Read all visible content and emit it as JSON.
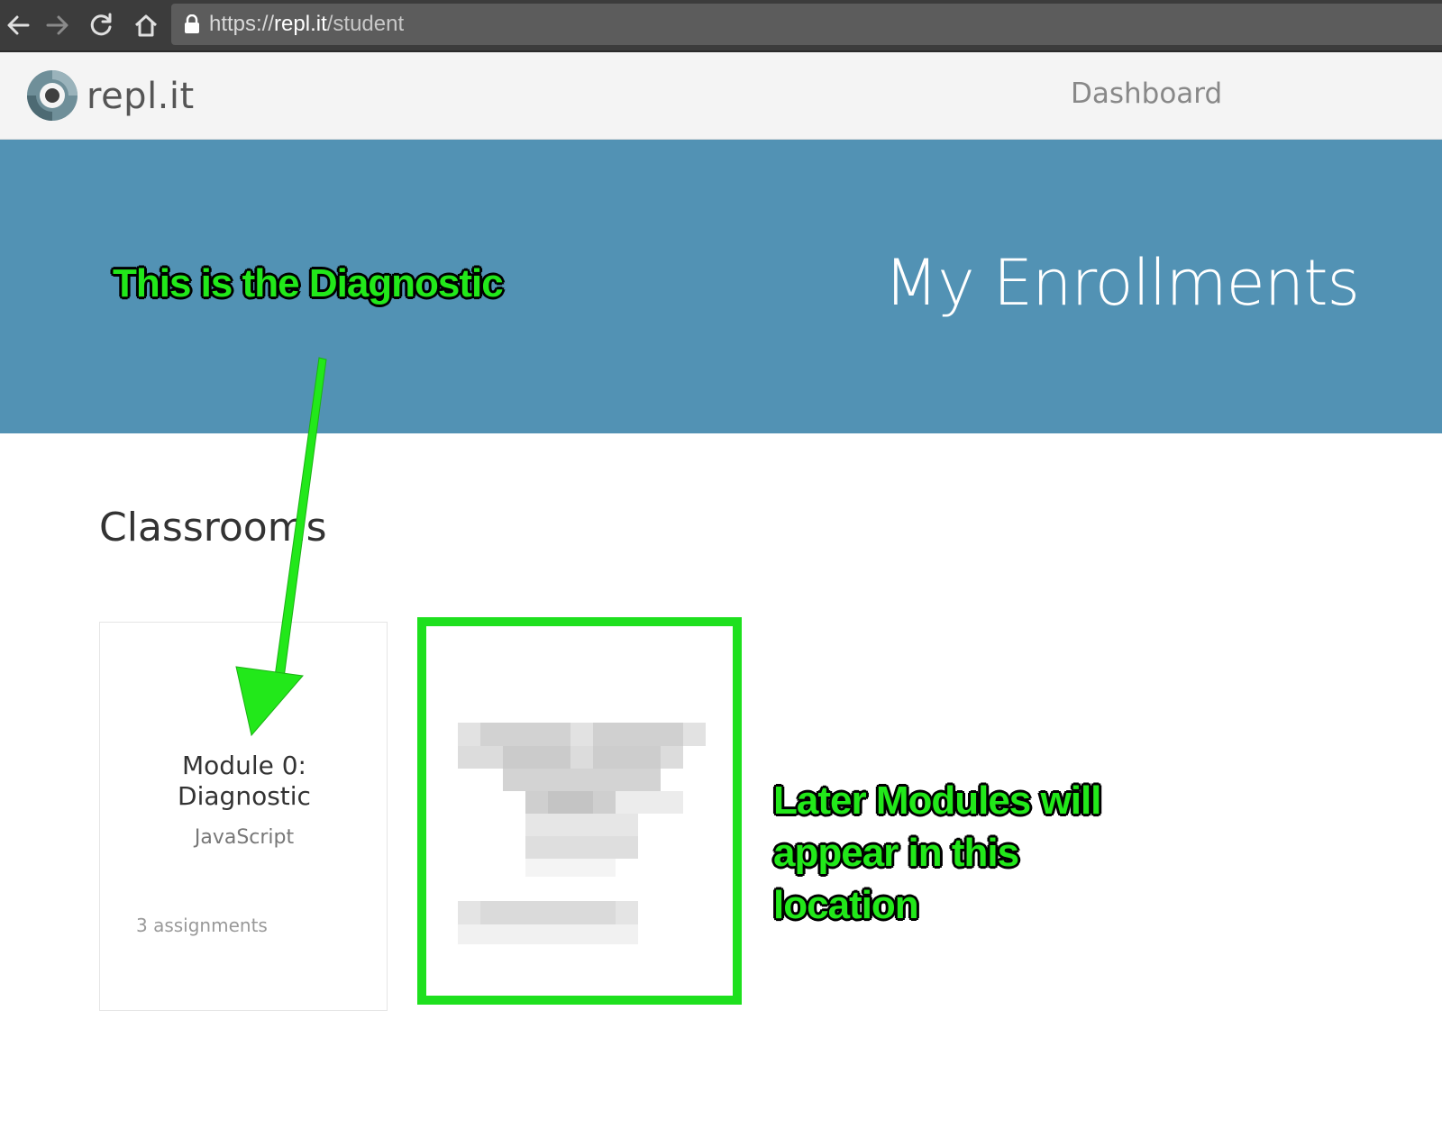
{
  "browser": {
    "url_scheme": "https://",
    "url_host": "repl.it",
    "url_path": "/student"
  },
  "header": {
    "logo_text": "repl.it",
    "nav_dashboard": "Dashboard"
  },
  "hero": {
    "title": "My Enrollments"
  },
  "content": {
    "section_title": "Classrooms",
    "classrooms": [
      {
        "title_line1": "Module 0:",
        "title_line2": "Diagnostic",
        "language": "JavaScript",
        "assignments": "3 assignments"
      }
    ]
  },
  "annotations": {
    "diagnostic_label": "This is the Diagnostic",
    "later_modules_label": "Later Modules will appear in this location"
  },
  "colors": {
    "hero_bg": "#5292b4",
    "annotation_green": "#22e81a",
    "highlight_border": "#1ee01e"
  }
}
